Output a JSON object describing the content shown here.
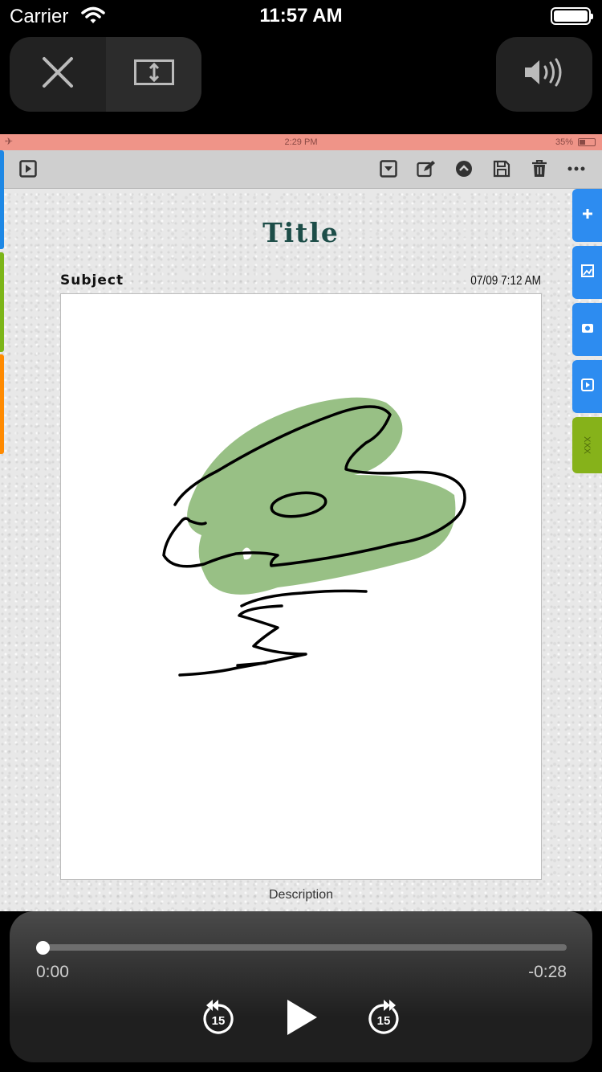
{
  "status_bar": {
    "carrier": "Carrier",
    "time": "11:57 AM"
  },
  "player_controls": {
    "close_icon": "close-icon",
    "resize_icon": "resize-icon",
    "volume_icon": "volume-icon"
  },
  "app": {
    "status": {
      "time": "2:29 PM",
      "battery": "35%"
    },
    "toolbar": {
      "left_icon": "play-square-icon",
      "right_icons": [
        "dropdown-square-icon",
        "edit-icon",
        "arrow-up-circle-icon",
        "save-icon",
        "trash-icon",
        "more-icon"
      ]
    },
    "left_tabs_colors": [
      "#1e88e5",
      "#7cb518",
      "#ff8a00"
    ],
    "right_tabs": [
      {
        "icon": "plus-icon",
        "color": "#2d8cf0"
      },
      {
        "icon": "image-edit-icon",
        "color": "#2d8cf0"
      },
      {
        "icon": "camera-icon",
        "color": "#2d8cf0"
      },
      {
        "icon": "video-icon",
        "color": "#2d8cf0"
      },
      {
        "label": "XXX",
        "color": "#86b21a"
      }
    ],
    "note": {
      "title": "Title",
      "subject": "Subject",
      "datetime": "07/09  7:12 AM",
      "description": "Description",
      "fill_color": "#98c085"
    }
  },
  "player": {
    "elapsed": "0:00",
    "remaining": "-0:28",
    "progress": 0,
    "skip_back_label": "15",
    "skip_forward_label": "15"
  }
}
